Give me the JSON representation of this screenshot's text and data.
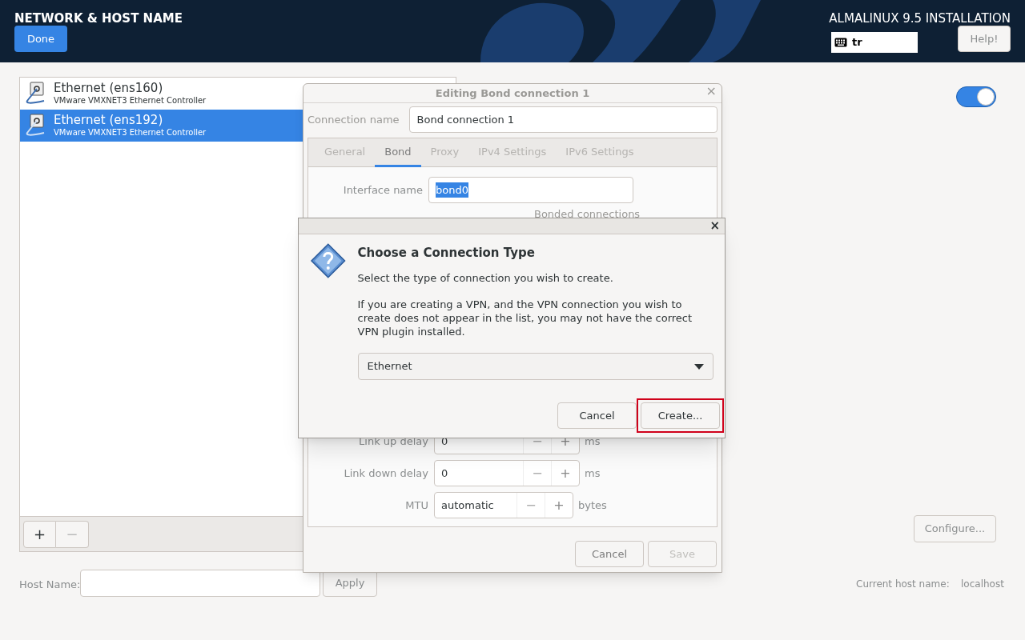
{
  "header": {
    "title": "NETWORK & HOST NAME",
    "done_button": "Done",
    "product": "ALMALINUX 9.5 INSTALLATION",
    "keyboard_layout": "tr",
    "help_button": "Help!"
  },
  "devices": [
    {
      "name": "Ethernet (ens160)",
      "description": "VMware VMXNET3 Ethernet Controller",
      "selected": false
    },
    {
      "name": "Ethernet (ens192)",
      "description": "VMware VMXNET3 Ethernet Controller",
      "selected": true
    }
  ],
  "list_buttons": [
    {
      "label": "+",
      "disabled": false
    },
    {
      "label": "−",
      "disabled": true
    }
  ],
  "device_switch": {
    "on": true
  },
  "configure_button": "Configure...",
  "host_name": {
    "label": "Host Name:",
    "apply_button": "Apply"
  },
  "current_host_name": {
    "label": "Current host name:",
    "value": "localhost"
  },
  "bond_dialog": {
    "title": "Editing Bond connection 1",
    "close": "×",
    "connection_name_label": "Connection name",
    "connection_name": "Bond connection 1",
    "tabs": [
      {
        "label": "General",
        "selected": false
      },
      {
        "label": "Bond",
        "selected": true
      },
      {
        "label": "Proxy",
        "selected": false
      },
      {
        "label": "IPv4 Settings",
        "selected": false
      },
      {
        "label": "IPv6 Settings",
        "selected": false
      }
    ],
    "interface_name_label": "Interface name",
    "interface_name": "bond0",
    "bonded_connections_label": "Bonded connections",
    "spin_rows": [
      {
        "label": "Link up delay",
        "value": "0",
        "unit": "ms",
        "minus": "−",
        "plus": "+"
      },
      {
        "label": "Link down delay",
        "value": "0",
        "unit": "ms",
        "minus": "−",
        "plus": "+"
      },
      {
        "label": "MTU",
        "value": "automatic",
        "unit": "bytes",
        "minus": "−",
        "plus": "+"
      }
    ],
    "buttons": [
      {
        "label": "Cancel",
        "disabled": false
      },
      {
        "label": "Save",
        "disabled": true
      }
    ]
  },
  "choose_dialog": {
    "close": "×",
    "heading": "Choose a Connection Type",
    "intro": "Select the type of connection you wish to create.",
    "note": "If you are creating a VPN, and the VPN connection you wish to create does not appear in the list, you may not have the correct VPN plugin installed.",
    "connection_type": "Ethernet",
    "buttons": [
      {
        "label": "Cancel",
        "highlighted": false
      },
      {
        "label": "Create...",
        "highlighted": true
      }
    ]
  }
}
